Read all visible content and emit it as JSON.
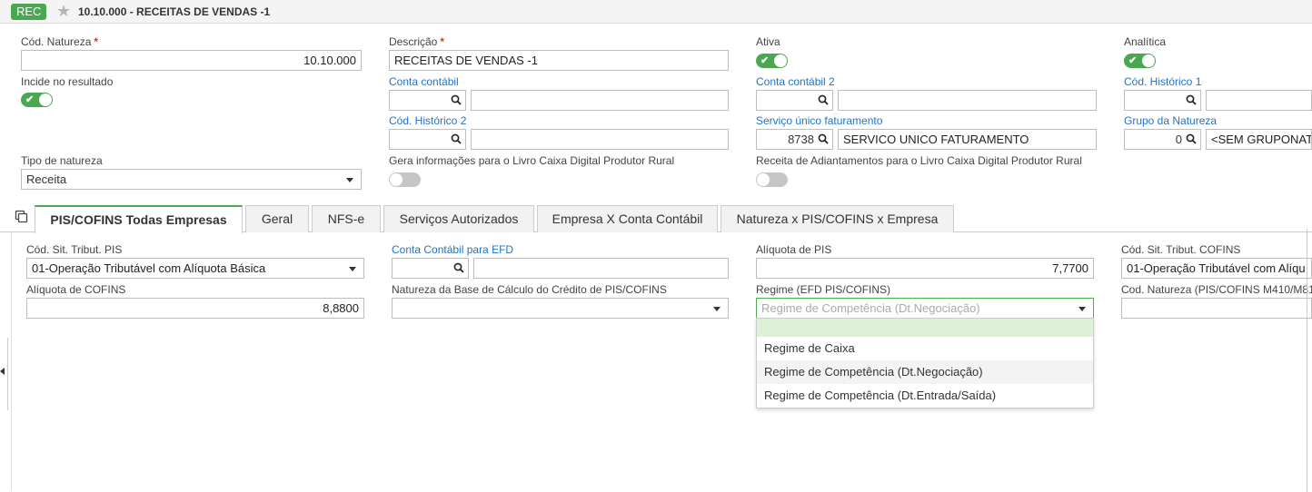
{
  "header": {
    "badge": "REC",
    "title": "10.10.000 - RECEITAS DE VENDAS -1"
  },
  "form": {
    "cod_natureza_label": "Cód. Natureza",
    "cod_natureza_value": "10.10.000",
    "descricao_label": "Descrição",
    "descricao_value": "RECEITAS DE VENDAS -1",
    "ativa_label": "Ativa",
    "analitica_label": "Analítica",
    "incide_label": "Incide no resultado",
    "conta_contabil_label": "Conta contábil",
    "conta_contabil2_label": "Conta contábil 2",
    "cod_historico1_label": "Cód. Histórico 1",
    "cod_historico2_label": "Cód. Histórico 2",
    "servico_label": "Serviço único faturamento",
    "servico_code": "8738",
    "servico_value": "SERVICO UNICO FATURAMENTO",
    "grupo_label": "Grupo da Natureza",
    "grupo_code": "0",
    "grupo_value": "<SEM GRUPONAT",
    "tipo_label": "Tipo de natureza",
    "tipo_value": "Receita",
    "livro_label": "Gera informações para o Livro Caixa Digital Produtor Rural",
    "adiant_label": "Receita de Adiantamentos para o Livro Caixa Digital Produtor Rural"
  },
  "tabs": [
    {
      "label": "PIS/COFINS Todas Empresas"
    },
    {
      "label": "Geral"
    },
    {
      "label": "NFS-e"
    },
    {
      "label": "Serviços Autorizados"
    },
    {
      "label": "Empresa X Conta Contábil"
    },
    {
      "label": "Natureza x PIS/COFINS x Empresa"
    }
  ],
  "pis": {
    "cst_pis_label": "Cód. Sit. Tribut. PIS",
    "cst_pis_value": "01-Operação Tributável com Alíquota Básica",
    "conta_efd_label": "Conta Contábil para EFD",
    "aliq_pis_label": "Alíquota de PIS",
    "aliq_pis_value": "7,7700",
    "cst_cofins_label": "Cód. Sit. Tribut. COFINS",
    "cst_cofins_value": "01-Operação Tributável com Alíqu",
    "aliq_cofins_label": "Alíquota de COFINS",
    "aliq_cofins_value": "8,8800",
    "natureza_base_label": "Natureza da Base de Cálculo do Crédito de PIS/COFINS",
    "regime_label": "Regime (EFD PIS/COFINS)",
    "regime_value": "Regime de Competência (Dt.Negociação)",
    "cod_natureza_m410_label": "Cod. Natureza (PIS/COFINS M410/M81"
  },
  "dropdown": {
    "options": [
      "Regime de Caixa",
      "Regime de Competência (Dt.Negociação)",
      "Regime de Competência (Dt.Entrada/Saída)"
    ]
  },
  "colors": {
    "accent": "#4aa852",
    "link": "#1f73c8",
    "required": "#d9342b"
  },
  "icons": [
    "star-icon",
    "search-icon",
    "copy-icon",
    "chevron-down-icon",
    "check-icon"
  ]
}
